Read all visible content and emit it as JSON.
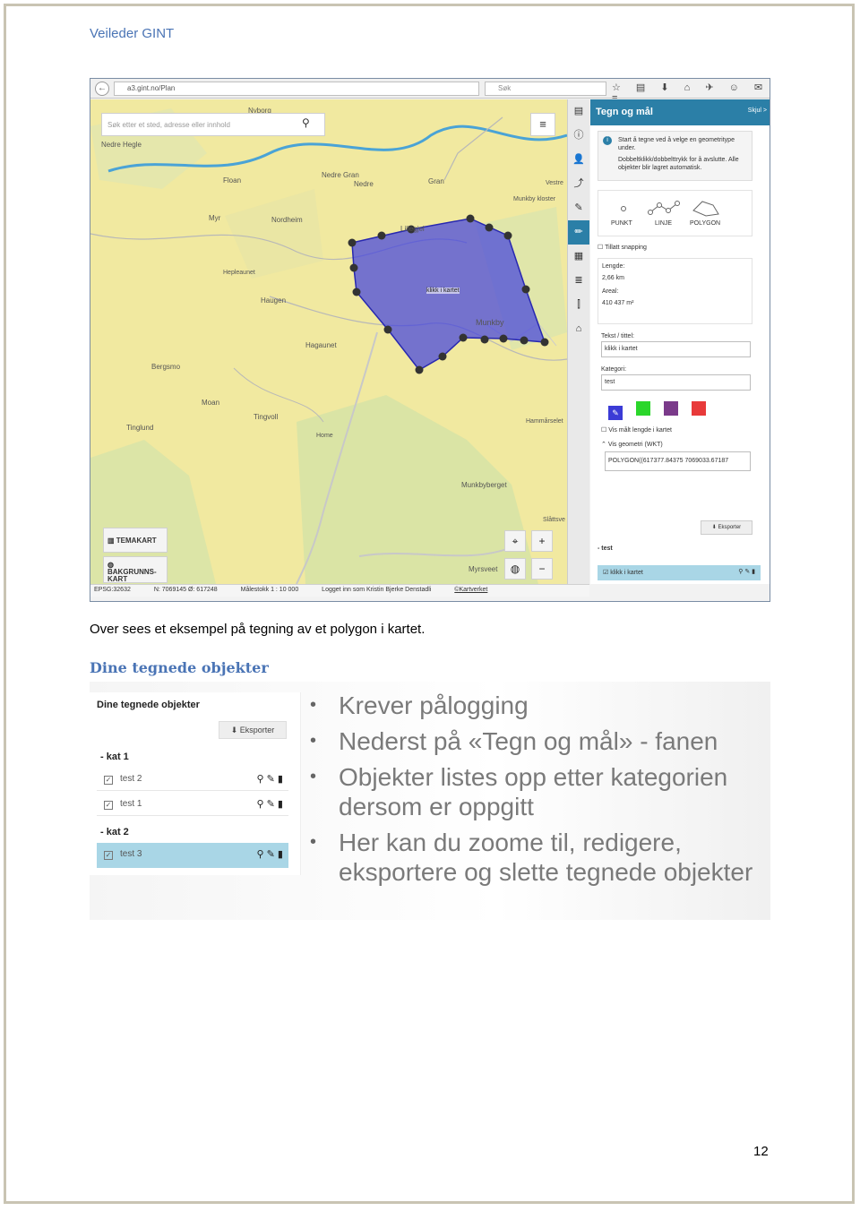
{
  "header": {
    "title": "Veileder GINT"
  },
  "browser": {
    "url": "a3.gint.no/Plan",
    "search_placeholder": "Søk",
    "back_icon": "arrow-left-icon",
    "toolbar_icons": "☆ ▤ ⬇ ⌂ ✈ ☺ ✉ ≡"
  },
  "map": {
    "search_placeholder": "Søk etter et sted, adresse eller innhold",
    "polygon_label": "klikk i kartet",
    "place_names": [
      "Nyborg",
      "Nedre Hegle",
      "Floan",
      "Nedre Gran",
      "Nedre",
      "Gran",
      "Myr",
      "Nordheim",
      "Hepleaunet",
      "Haugen",
      "Lillegjel",
      "Munkby",
      "Munkby kloster",
      "Hagaunet",
      "Bergsmo",
      "Moan",
      "Tingvoll",
      "Tinglund",
      "Home",
      "Munkbyberget",
      "Hammårselet",
      "Slåttsve",
      "Myrsveet",
      "Vestre"
    ],
    "btn_temakart": "TEMAKART",
    "btn_bakgrunn": "BAKGRUNNS-KART",
    "zoom_in": "+",
    "zoom_out": "−",
    "locate": "⌖",
    "globe": "◍"
  },
  "toolstrip": [
    "▤",
    "ⓘ",
    "👤",
    "⤴",
    "✎",
    "✏",
    "▦",
    "≣",
    "⫿",
    "⌂"
  ],
  "panel": {
    "title": "Tegn og mål",
    "close_label": "Skjul >",
    "info_line1": "Start å tegne ved å velge en geometritype under.",
    "info_line2": "Dobbeltklikk/dobbelttrykk for å avslutte. Alle objekter blir lagret automatisk.",
    "geom_point": "PUNKT",
    "geom_line": "LINJE",
    "geom_polygon": "POLYGON",
    "snap_label": "Tillatt snapping",
    "length_label": "Lengde:",
    "length_value": "2,66 km",
    "area_label": "Areal:",
    "area_value": "410 437 m²",
    "text_label": "Tekst / tittel:",
    "text_value": "klikk i kartet",
    "category_label": "Kategori:",
    "category_value": "test",
    "colors": [
      "#3b3bd6",
      "#2bd62b",
      "#7a3a8a",
      "#e83a3a"
    ],
    "show_length_label": "Vis målt lengde i kartet",
    "show_wkt_label": "Vis geometri (WKT)",
    "wkt_value": "POLYGON((617377.84375 7069033.67187",
    "export_label": "Eksporter",
    "group_label": "- test",
    "row_label": "klikk i kartet"
  },
  "statusbar": {
    "epsg": "EPSG:32632",
    "coords": "N: 7069145 Ø: 617248",
    "scale": "Målestokk 1 : 10 000",
    "login": "Logget inn som Kristin Bjerke Denstadli",
    "credit": "©Kartverket"
  },
  "caption": "Over sees et eksempel på tegning av et polygon i kartet.",
  "section_heading": "Dine tegnede objekter",
  "slide": {
    "panel_title": "Dine tegnede objekter",
    "export_label": "Eksporter",
    "groups": [
      {
        "label": "- kat 1",
        "rows": [
          "test 2",
          "test 1"
        ]
      },
      {
        "label": "- kat 2",
        "rows": [
          "test 3"
        ]
      }
    ],
    "bullets": [
      "Krever pålogging",
      "Nederst på «Tegn og mål» - fanen",
      "Objekter listes opp etter kategorien dersom er oppgitt",
      "Her kan du zoome til, redigere, eksportere og slette tegnede objekter"
    ]
  },
  "page_number": "12"
}
